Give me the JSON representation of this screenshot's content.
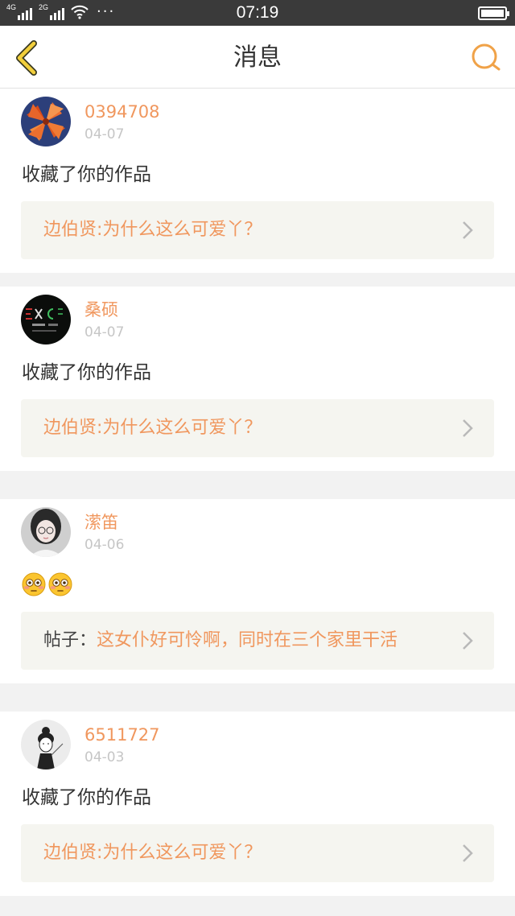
{
  "status_bar": {
    "network_1": "4G",
    "network_2": "2G",
    "time": "07:19",
    "more": "···"
  },
  "header": {
    "title": "消息",
    "accent_color": "#f0a248"
  },
  "notifications": [
    {
      "username": "0394708",
      "date": "04-07",
      "action": "收藏了你的作品",
      "reference_prefix": "",
      "reference": "边伯贤:为什么这么可爱丫？"
    },
    {
      "username": "桑硕",
      "date": "04-07",
      "action": "收藏了你的作品",
      "reference_prefix": "",
      "reference": "边伯贤:为什么这么可爱丫？"
    },
    {
      "username": "潆笛",
      "date": "04-06",
      "action": "",
      "emojis": [
        "flushed-face-emoji",
        "flushed-face-emoji"
      ],
      "reference_prefix": "帖子：",
      "reference": "这女仆好可怜啊，同时在三个家里干活"
    },
    {
      "username": "6511727",
      "date": "04-03",
      "action": "收藏了你的作品",
      "reference_prefix": "",
      "reference": "边伯贤:为什么这么可爱丫？"
    }
  ]
}
